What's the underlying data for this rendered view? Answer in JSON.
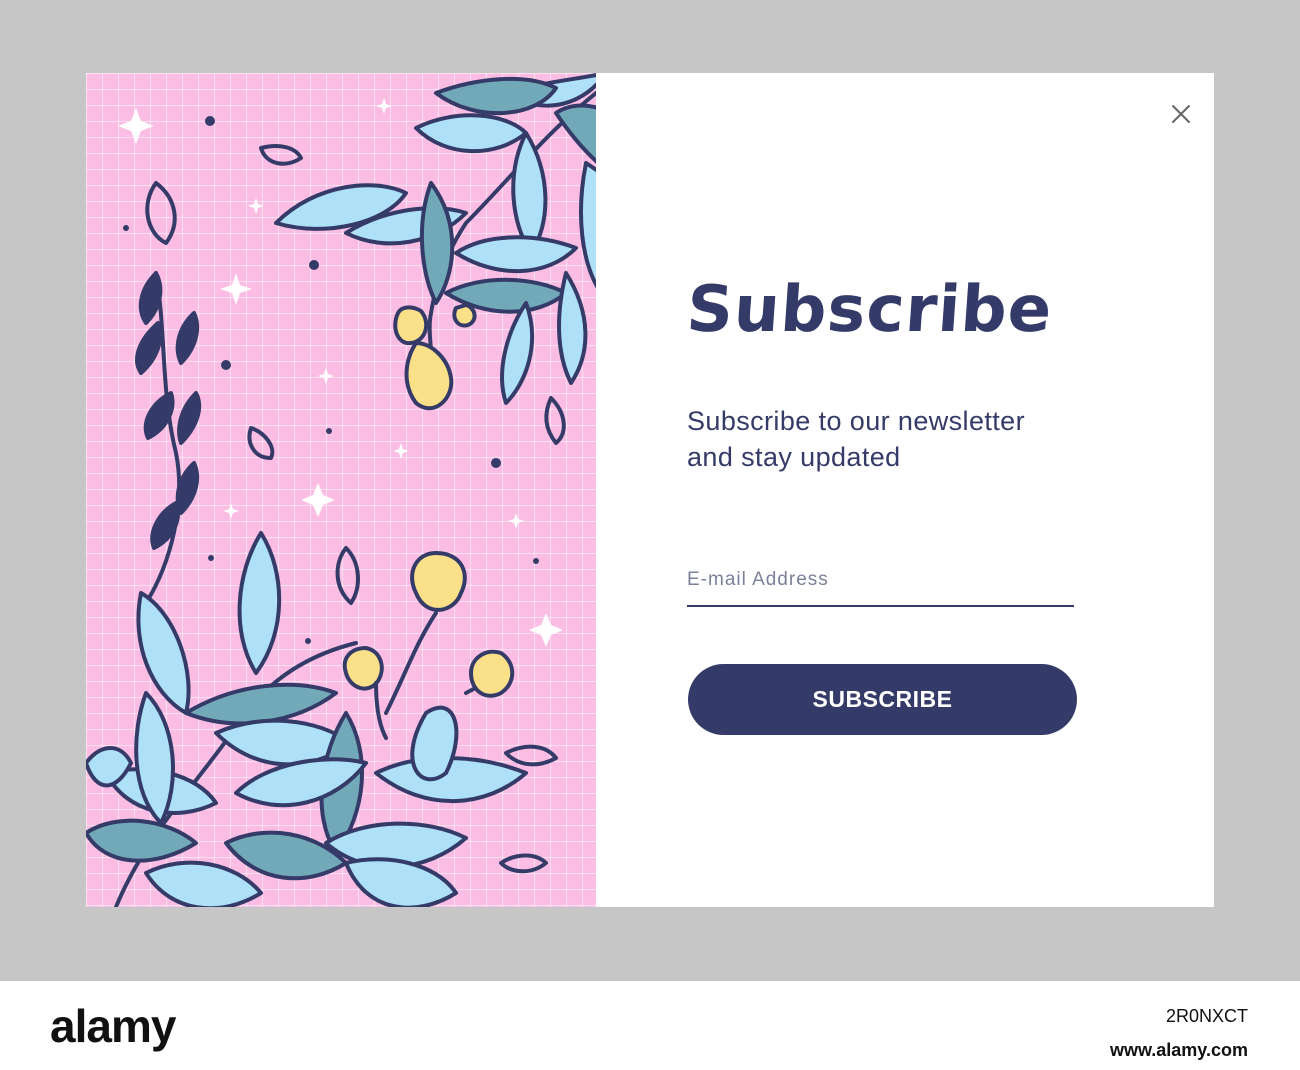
{
  "popup": {
    "title": "Subscribe",
    "subtitle_line1": "Subscribe to our newsletter",
    "subtitle_line2": "and stay updated",
    "email_placeholder": "E-mail Address",
    "button_label": "SUBSCRIBE",
    "close_icon": "close-icon"
  },
  "illustration": {
    "description_icon": "floral-illustration",
    "background_color": "#fbbde3",
    "leaf_color": "#aee0f7",
    "dark_leaf_color": "#72a9b8",
    "flower_color": "#fbe08a",
    "outline_color": "#353b68"
  },
  "footer": {
    "logo": "alamy",
    "image_id": "2R0NXCT",
    "site": "www.alamy.com"
  },
  "watermark": "alamy"
}
